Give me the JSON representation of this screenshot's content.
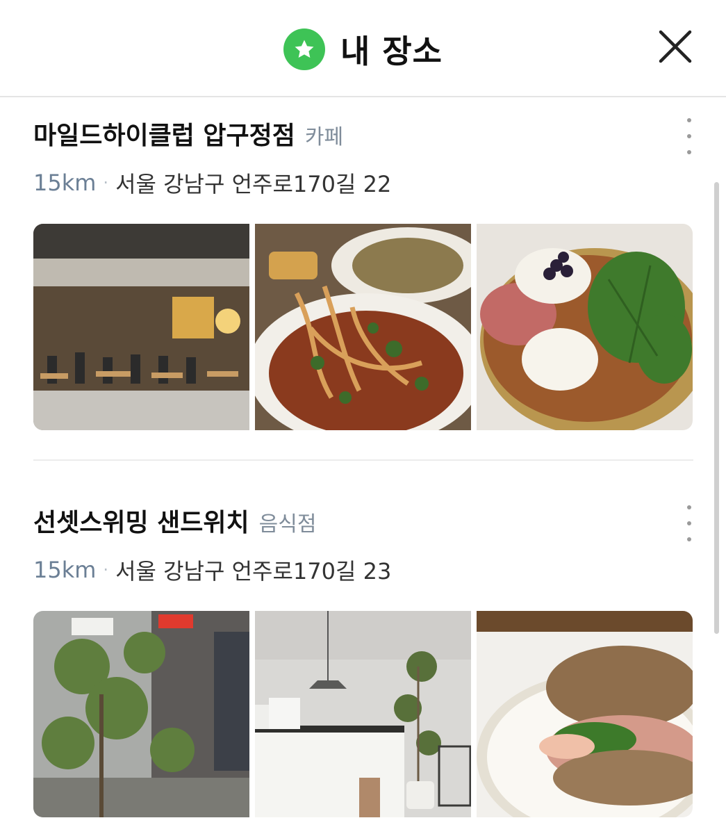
{
  "header": {
    "title": "내 장소",
    "star_icon": "star-icon",
    "close_icon": "close-icon"
  },
  "places": [
    {
      "name": "마일드하이클럽 압구정점",
      "category": "카페",
      "distance": "15km",
      "separator": "·",
      "address": "서울 강남구 언주로170길 22"
    },
    {
      "name": "선셋스위밍 샌드위치",
      "category": "음식점",
      "distance": "15km",
      "separator": "·",
      "address": "서울 강남구 언주로170길 23"
    }
  ],
  "colors": {
    "accent_green": "#3ec356",
    "category_gray": "#7f8c9a",
    "distance_blue_gray": "#6b7f95"
  }
}
